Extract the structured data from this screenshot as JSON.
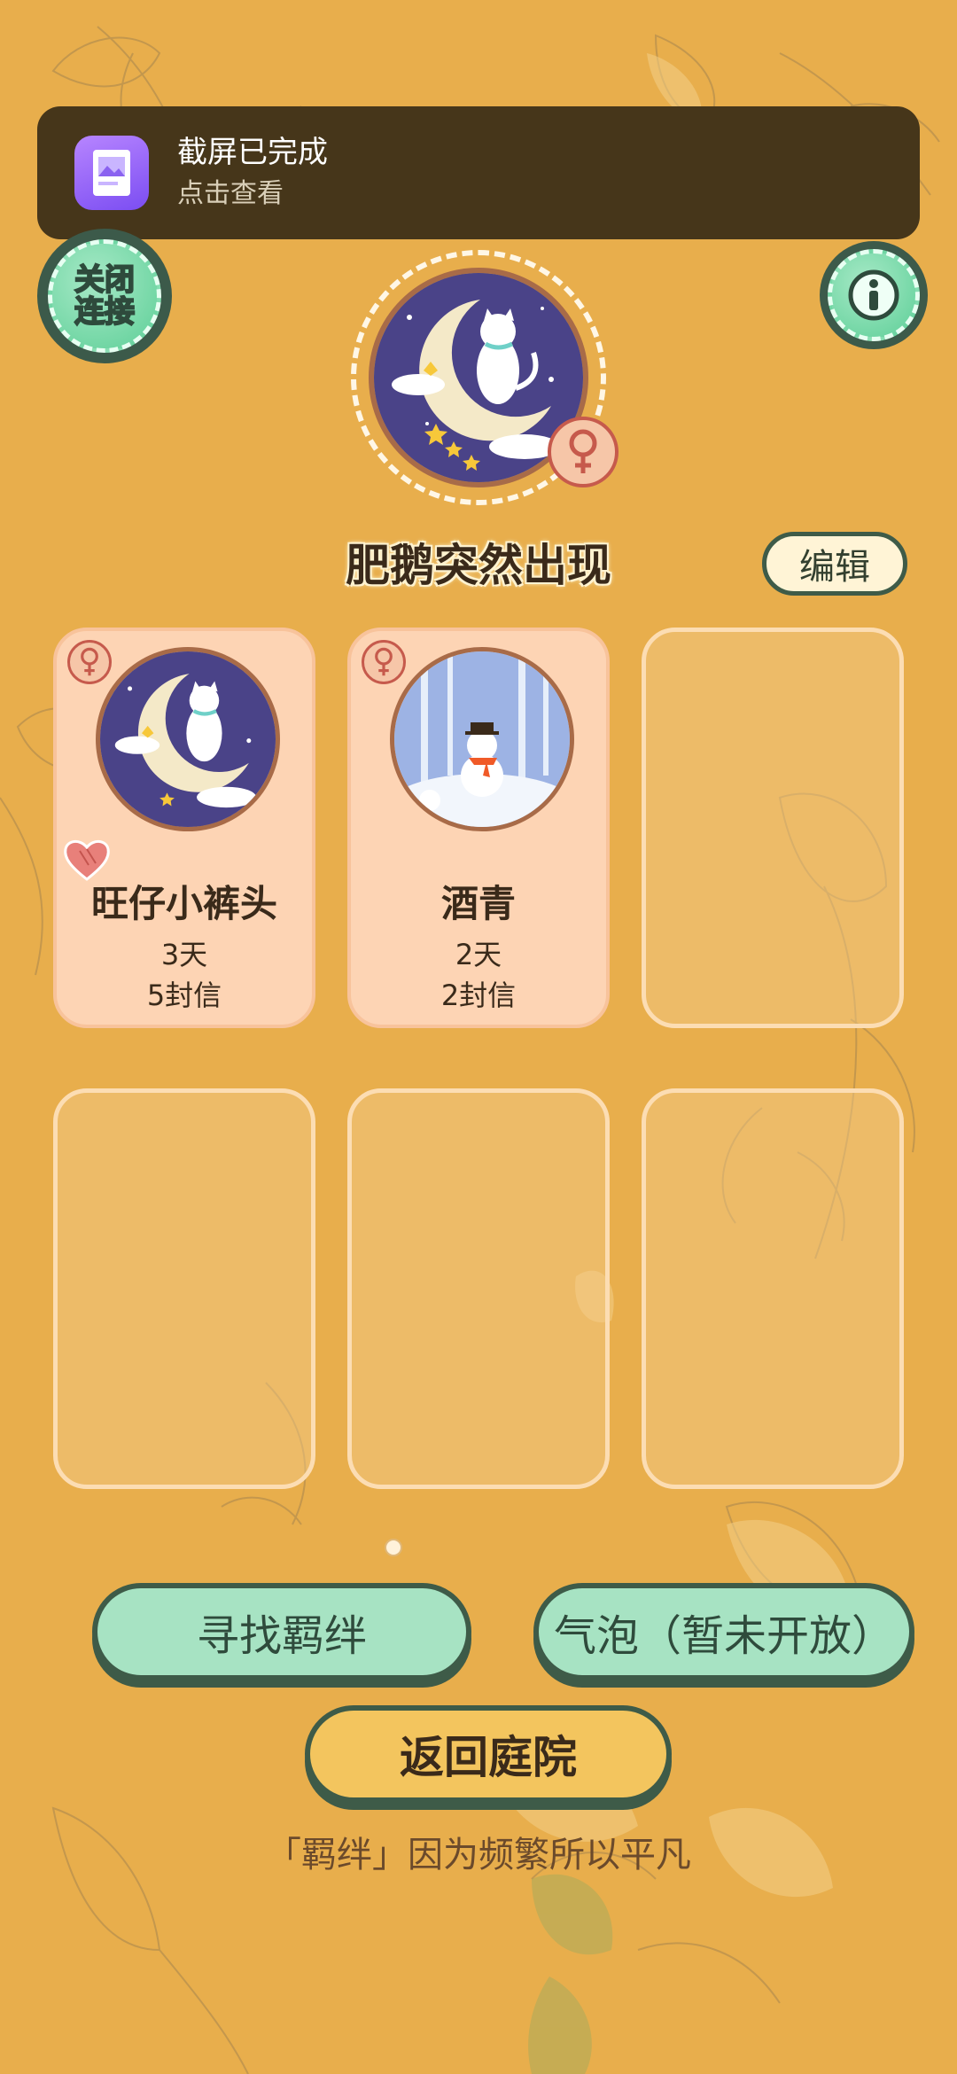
{
  "notification": {
    "title": "截屏已完成",
    "subtitle": "点击查看",
    "icon": "screenshot-icon"
  },
  "header": {
    "close_connection_label": "关闭连接",
    "info_icon": "info-icon"
  },
  "profile": {
    "name": "肥鹅突然出现",
    "gender": "female",
    "avatar": "cat-on-moon",
    "edit_label": "编辑"
  },
  "slots": [
    {
      "name": "旺仔小裤头",
      "days": "3天",
      "letters": "5封信",
      "gender": "female",
      "avatar": "cat-on-moon",
      "favorite": true
    },
    {
      "name": "酒青",
      "days": "2天",
      "letters": "2封信",
      "gender": "female",
      "avatar": "snowman-forest",
      "favorite": false
    }
  ],
  "buttons": {
    "find_bond": "寻找羁绊",
    "bubble": "气泡（暂未开放）",
    "return_courtyard": "返回庭院"
  },
  "footer_quote": "「羁绊」因为频繁所以平凡",
  "colors": {
    "background": "#E8AE4C",
    "toast": "#46361A",
    "green_button": "#A7E3C3",
    "yellow_button": "#F3C55E",
    "card_filled": "#FDD4B4",
    "outline": "#3E5B48"
  }
}
